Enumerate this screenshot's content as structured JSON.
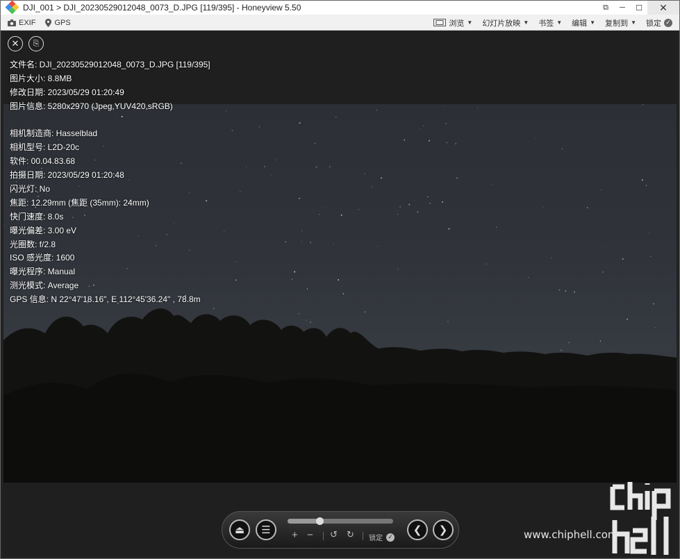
{
  "window": {
    "title": "DJI_001 > DJI_20230529012048_0073_D.JPG [119/395] - Honeyview 5.50",
    "controls": {
      "pin": "⧉",
      "minimize": "─",
      "maximize": "☐",
      "close": "✕"
    }
  },
  "toolbar": {
    "left": [
      {
        "icon": "camera-icon",
        "label": "EXIF"
      },
      {
        "icon": "location-pin-icon",
        "label": "GPS"
      }
    ],
    "right": [
      {
        "label": "浏览",
        "has_icon": true
      },
      {
        "label": "幻灯片放映"
      },
      {
        "label": "书签"
      },
      {
        "label": "编辑"
      },
      {
        "label": "复制到"
      }
    ],
    "lock_label": "锁定"
  },
  "viewer": {
    "close_icon": "close-icon",
    "copy_icon": "copy-info-icon",
    "exif_lines_top": [
      "文件名: DJI_20230529012048_0073_D.JPG [119/395]",
      "图片大小: 8.8MB",
      "修改日期: 2023/05/29 01:20:49",
      "图片信息: 5280x2970 (Jpeg,YUV420,sRGB)"
    ],
    "exif_lines_bottom": [
      "相机制造商: Hasselblad",
      "相机型号: L2D-20c",
      "软件: 00.04.83.68",
      "拍摄日期: 2023/05/29 01:20:48",
      "闪光灯: No",
      "焦距: 12.29mm (焦距 (35mm): 24mm)",
      "快门速度: 8.0s",
      "曝光偏差: 3.00 eV",
      "光圈数: f/2.8",
      "ISO 感光度: 1600",
      "曝光程序: Manual",
      "测光模式: Average",
      "GPS 信息: N 22°47'18.16\", E 112°45'36.24\" , 78.8m"
    ]
  },
  "controlbar": {
    "eject_icon": "eject-icon",
    "menu_icon": "menu-icon",
    "zoom_in": "+",
    "zoom_out": "−",
    "rotate_left": "↺",
    "rotate_right": "↻",
    "lock_label": "锁定",
    "position_fraction": 0.3,
    "prev_icon": "chevron-left-icon",
    "next_icon": "chevron-right-icon"
  },
  "watermark": {
    "url": "www.chiphell.com",
    "logo_text": "chip hell"
  },
  "colors": {
    "titlebar_bg": "#ffffff",
    "toolbar_bg": "#f1f1f1",
    "viewer_bg": "#1f1f1f",
    "text_light": "#ffffff"
  }
}
